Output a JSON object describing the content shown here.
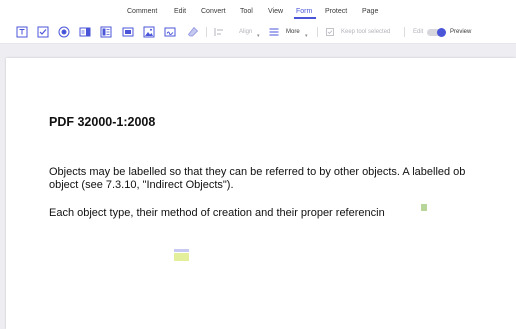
{
  "menu": {
    "items": [
      {
        "label": "Comment"
      },
      {
        "label": "Edit"
      },
      {
        "label": "Convert"
      },
      {
        "label": "Tool"
      },
      {
        "label": "View"
      },
      {
        "label": "Form"
      },
      {
        "label": "Protect"
      },
      {
        "label": "Page"
      }
    ],
    "active": "Form"
  },
  "toolbar": {
    "align_label": "Align",
    "more_label": "More",
    "keep_tool_label": "Keep tool selected",
    "edit_label": "Edit",
    "preview_label": "Preview",
    "icons": [
      "text-field-icon",
      "checkbox-icon",
      "radio-button-icon",
      "combo-box-icon",
      "list-box-icon",
      "button-field-icon",
      "image-field-icon",
      "signature-field-icon",
      "clear-form-icon",
      "align-icon",
      "more-icon"
    ]
  },
  "document": {
    "title": "PDF 32000-1:2008",
    "paragraph1_line1": "Objects may be labelled so that they can be referred to by other objects. A labelled ob",
    "paragraph1_line2": "object (see 7.3.10, \"Indirect Objects\").",
    "paragraph2": "Each object type, their method of creation and their proper referencin"
  },
  "colors": {
    "accent": "#4a55d8",
    "text": "#111111",
    "chrome": "#f4f4f6"
  }
}
